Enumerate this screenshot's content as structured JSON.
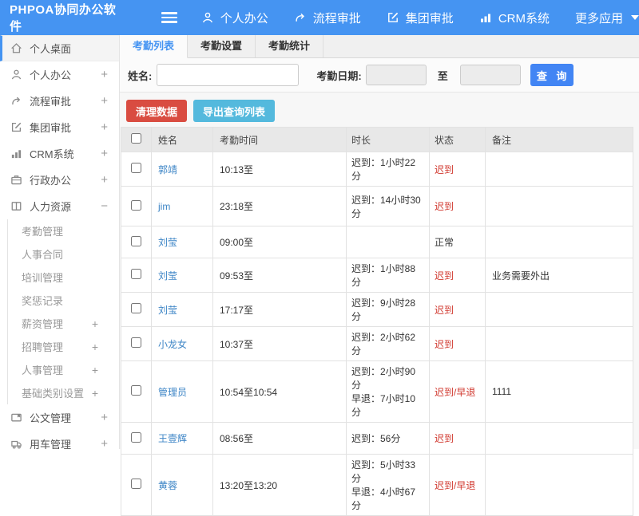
{
  "topbar": {
    "brand": "PHPOA协同办公软件",
    "nav": [
      {
        "label": "个人办公",
        "icon": "person-icon"
      },
      {
        "label": "流程审批",
        "icon": "flow-icon"
      },
      {
        "label": "集团审批",
        "icon": "edit-icon"
      },
      {
        "label": "CRM系统",
        "icon": "chart-icon"
      },
      {
        "label": "更多应用",
        "icon": "caret-down-icon"
      }
    ]
  },
  "sidebar": {
    "items": [
      {
        "label": "个人桌面",
        "icon": "home-icon"
      },
      {
        "label": "个人办公",
        "icon": "person-icon",
        "expand": "+"
      },
      {
        "label": "流程审批",
        "icon": "flow-icon",
        "expand": "+"
      },
      {
        "label": "集团审批",
        "icon": "edit-icon",
        "expand": "+"
      },
      {
        "label": "CRM系统",
        "icon": "chart-icon",
        "expand": "+"
      },
      {
        "label": "行政办公",
        "icon": "briefcase-icon",
        "expand": "+"
      },
      {
        "label": "人力资源",
        "icon": "book-icon",
        "expand": "−"
      }
    ],
    "submenu": [
      {
        "label": "考勤管理",
        "expand": ""
      },
      {
        "label": "人事合同",
        "expand": ""
      },
      {
        "label": "培训管理",
        "expand": ""
      },
      {
        "label": "奖惩记录",
        "expand": ""
      },
      {
        "label": "薪资管理",
        "expand": "+"
      },
      {
        "label": "招聘管理",
        "expand": "+"
      },
      {
        "label": "人事管理",
        "expand": "+"
      },
      {
        "label": "基础类别设置",
        "expand": "+"
      }
    ],
    "items_after": [
      {
        "label": "公文管理",
        "icon": "doc-icon",
        "expand": "+"
      },
      {
        "label": "用车管理",
        "icon": "car-icon",
        "expand": "+"
      }
    ]
  },
  "tabs": [
    {
      "label": "考勤列表"
    },
    {
      "label": "考勤设置"
    },
    {
      "label": "考勤统计"
    }
  ],
  "filter": {
    "name_label": "姓名:",
    "date_label": "考勤日期:",
    "to_label": "至",
    "search_button": "查 询"
  },
  "actions": {
    "clear_button": "清理数据",
    "export_button": "导出查询列表"
  },
  "table": {
    "headers": [
      "姓名",
      "考勤时间",
      "时长",
      "状态",
      "备注"
    ],
    "rows": [
      {
        "name": "郭靖",
        "time": "10:13至",
        "duration": "迟到：1小时22分",
        "status": "迟到",
        "note": ""
      },
      {
        "name": "jim",
        "time": "23:18至",
        "duration": "迟到：14小时30分",
        "status": "迟到",
        "note": ""
      },
      {
        "name": "刘莹",
        "time": "09:00至",
        "duration": "",
        "status": "正常",
        "note": ""
      },
      {
        "name": "刘莹",
        "time": "09:53至",
        "duration": "迟到：1小时88分",
        "status": "迟到",
        "note": "业务需要外出"
      },
      {
        "name": "刘莹",
        "time": "17:17至",
        "duration": "迟到：9小时28分",
        "status": "迟到",
        "note": ""
      },
      {
        "name": "小龙女",
        "time": "10:37至",
        "duration": "迟到：2小时62分",
        "status": "迟到",
        "note": ""
      },
      {
        "name": "管理员",
        "time": "10:54至10:54",
        "duration": "迟到：2小时90分\n早退：7小时10分",
        "status": "迟到/早退",
        "note": "1111"
      },
      {
        "name": "王壹辉",
        "time": "08:56至",
        "duration": "迟到：56分",
        "status": "迟到",
        "note": ""
      },
      {
        "name": "黄蓉",
        "time": "13:20至13:20",
        "duration": "迟到：5小时33分\n早退：4小时67分",
        "status": "迟到/早退",
        "note": ""
      }
    ]
  },
  "colors": {
    "topbar_blue": "#4594f2",
    "primary_button_blue": "#4285f4",
    "danger_red": "#d94c41",
    "info_teal": "#54b9dd",
    "status_red": "#d0362c",
    "link_blue": "#3d85c6"
  }
}
